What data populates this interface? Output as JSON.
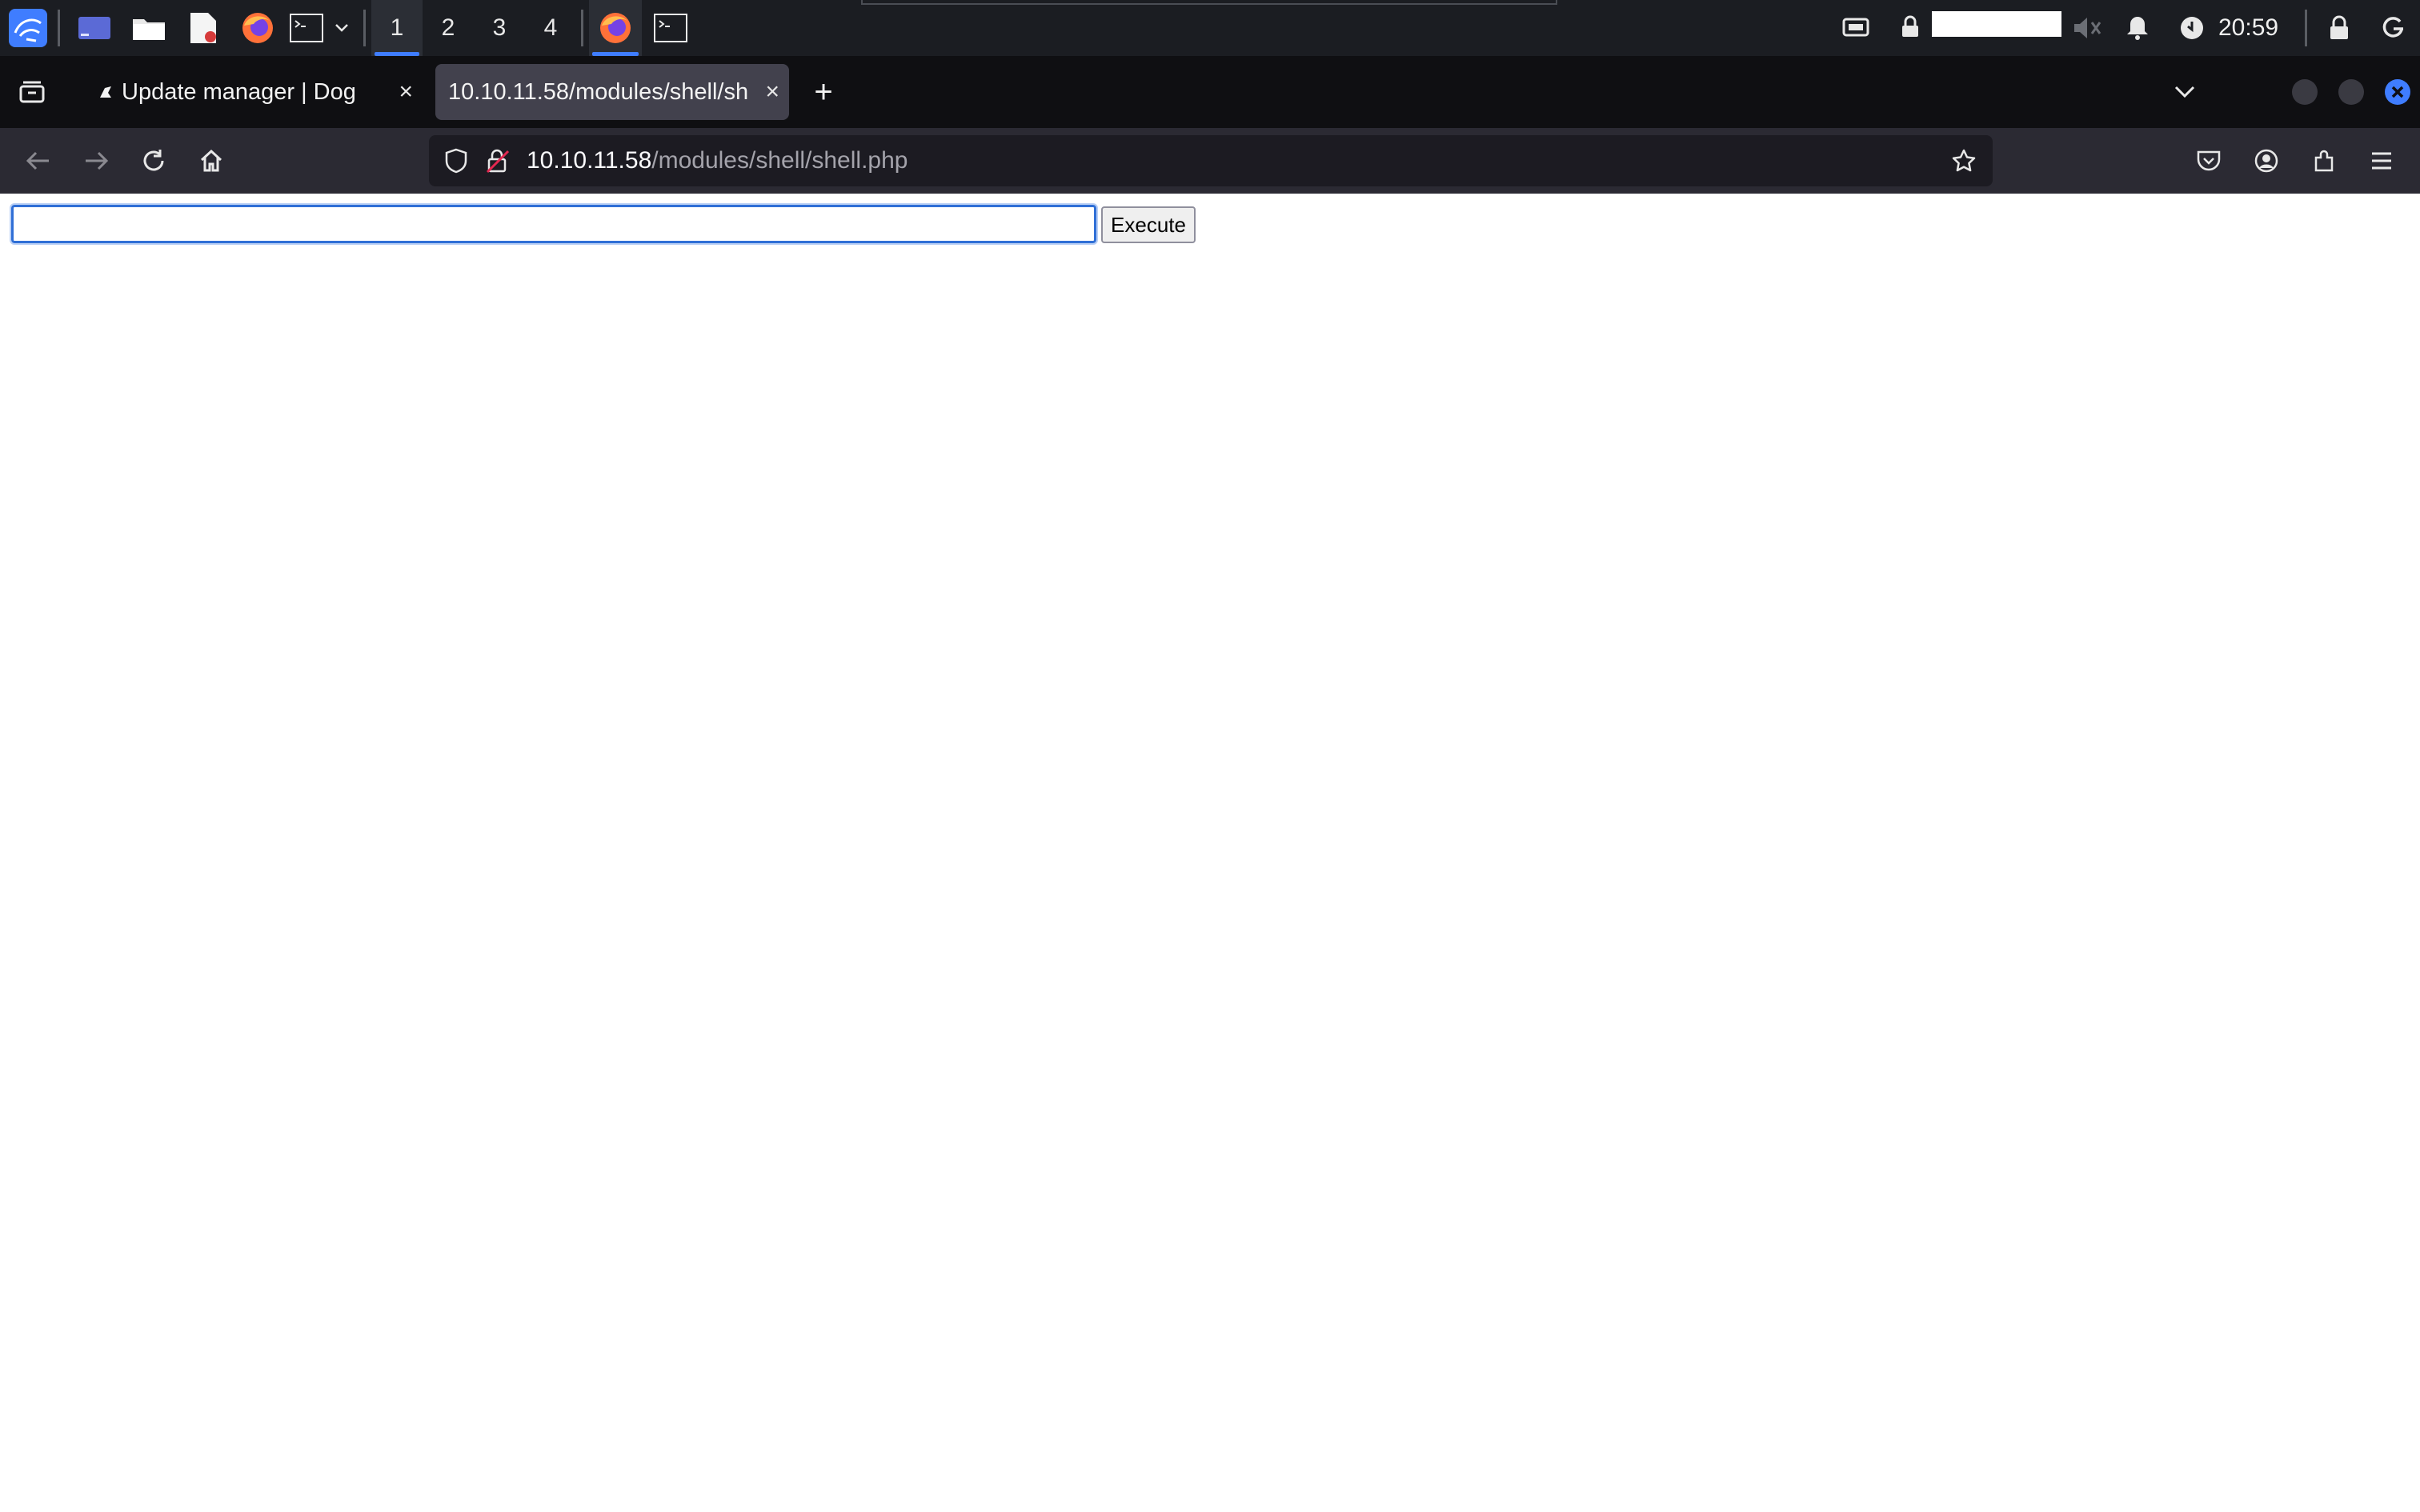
{
  "panel": {
    "workspaces": [
      "1",
      "2",
      "3",
      "4"
    ],
    "active_workspace": "1",
    "clock": "20:59",
    "launchers": [
      "kali-menu-icon",
      "show-desktop-icon",
      "file-manager-icon",
      "text-editor-icon",
      "firefox-icon",
      "terminal-icon"
    ],
    "tray": [
      "screen-icon",
      "vpn-lock-icon",
      "volume-muted-icon",
      "bell-icon",
      "update-icon",
      "lock-screen-icon",
      "logout-icon"
    ]
  },
  "browser": {
    "tabs": [
      {
        "title": "Update manager | Dog",
        "close": "×"
      },
      {
        "title": "10.10.11.58/modules/shell/sh",
        "close": "×"
      }
    ],
    "new_tab": "+",
    "url_host": "10.10.11.58",
    "url_path": "/modules/shell/shell.php",
    "accent": "#3f7dff"
  },
  "page": {
    "command_value": "",
    "execute_label": "Execute"
  }
}
